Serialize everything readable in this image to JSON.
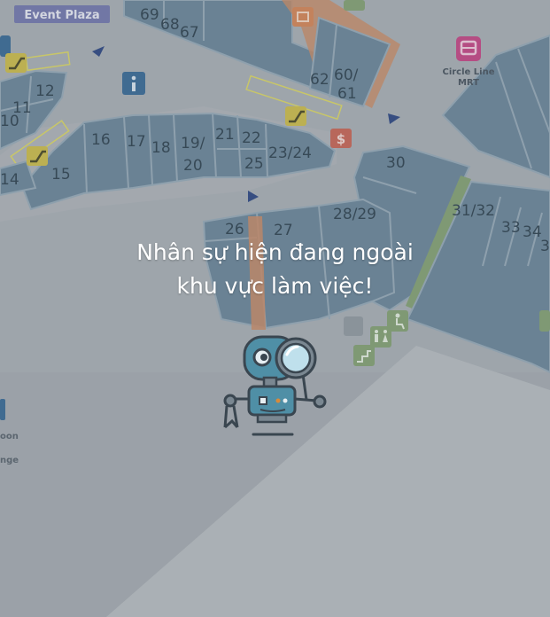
{
  "map": {
    "event_plaza_label": "Event Plaza",
    "mrt_label_line1": "Circle Line",
    "mrt_label_line2": "MRT",
    "edge_label_1": "oon",
    "edge_label_2": "nge",
    "units": {
      "u69": "69",
      "u68": "68",
      "u67": "67",
      "u62": "62",
      "u60_61a": "60/",
      "u60_61b": "61",
      "u12": "12",
      "u11": "11",
      "u10": "10",
      "u16": "16",
      "u17": "17",
      "u18": "18",
      "u19_20a": "19/",
      "u19_20b": "20",
      "u21": "21",
      "u22": "22",
      "u25": "25",
      "u23_24": "23/24",
      "u15": "15",
      "u14": "14",
      "u30": "30",
      "u26": "26",
      "u27": "27",
      "u28_29": "28/29",
      "u31_32": "31/32",
      "u33": "33",
      "u34": "34",
      "u3x": "3"
    },
    "icons": [
      "info-icon",
      "escalator-icon",
      "money-changer-icon",
      "mrt-icon",
      "wheelchair-icon",
      "restroom-icon",
      "direction-arrow-icon",
      "shop-bag-icon"
    ]
  },
  "overlay": {
    "message_line1": "Nhân sự hiện đang ngoài",
    "message_line2": "khu vực làm việc!",
    "illustration": "robot-magnifier-icon"
  },
  "colors": {
    "map_bg": "#9ea4ab",
    "unit_fill": "#607d93",
    "unit_stroke": "#8fa3b3",
    "overlay_text": "#ffffff",
    "highlight_orange": "#c8835a"
  }
}
